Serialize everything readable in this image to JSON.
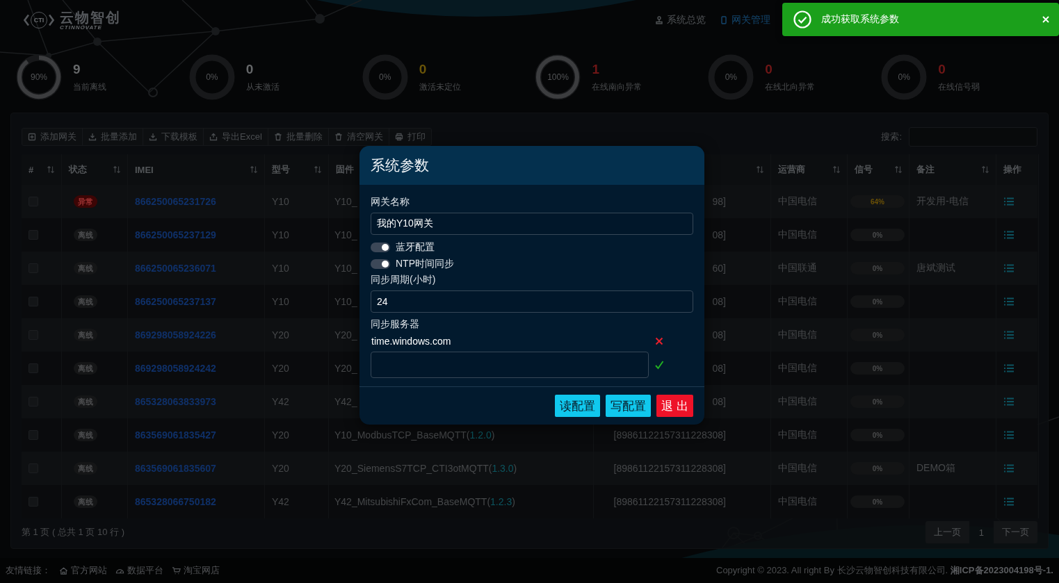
{
  "header": {
    "logo": {
      "mark": "CTI",
      "title": "云物智创",
      "subtitle": "CTINNOVATE"
    },
    "nav": [
      {
        "label": "系统总览",
        "selected": false
      },
      {
        "label": "网关管理",
        "selected": true
      }
    ]
  },
  "toast": {
    "message": "成功获取系统参数"
  },
  "stats": [
    {
      "percent": "90%",
      "level": 0.9,
      "value": "9",
      "label": "当前离线",
      "color": "#66686a"
    },
    {
      "percent": "0%",
      "value": "0",
      "label": "从未激活",
      "color": "#66686a"
    },
    {
      "percent": "0%",
      "value": "0",
      "label": "激活未定位",
      "color": "#6a5508"
    },
    {
      "percent": "100%",
      "level": 1,
      "value": "1",
      "label": "在线南向异常",
      "color": "#6e1616"
    },
    {
      "percent": "0%",
      "value": "0",
      "label": "在线北向异常",
      "color": "#6e1616"
    },
    {
      "percent": "0%",
      "value": "0",
      "label": "在线信号弱",
      "color": "#6e1616"
    }
  ],
  "toolbar": {
    "buttons": [
      "添加网关",
      "批量添加",
      "下载模板",
      "导出Excel",
      "批量删除",
      "清空网关",
      "打印"
    ],
    "search": {
      "label": "搜索:"
    }
  },
  "table": {
    "columns": [
      {
        "label": "#",
        "sortable": true
      },
      {
        "label": "状态",
        "sortable": true
      },
      {
        "label": "IMEI",
        "sortable": true
      },
      {
        "label": "型号",
        "sortable": true
      },
      {
        "label": "固件",
        "sortable": false
      },
      {
        "sortable": true
      },
      {
        "label": "运营商",
        "sortable": true
      },
      {
        "label": "信号",
        "sortable": true
      },
      {
        "label": "备注",
        "sortable": true
      },
      {
        "label": "操作",
        "sortable": false
      }
    ],
    "rows": [
      {
        "checked": false,
        "status": {
          "text": "异常",
          "kind": "error"
        },
        "imei": "866250065231726",
        "model": "Y10",
        "firmware": {
          "name": "Y10_"
        },
        "iccid": "98]",
        "carrier": "中国电信",
        "signal": {
          "text": "64%",
          "color": "#6a5006"
        },
        "remark": "开发用-电信"
      },
      {
        "checked": false,
        "status": {
          "text": "离线",
          "kind": "offline"
        },
        "imei": "866250065237129",
        "model": "Y10",
        "firmware": {
          "name": "Y10_"
        },
        "iccid": "08]",
        "carrier": "中国电信",
        "signal": {
          "text": "0%",
          "color": "#4a4b4c"
        }
      },
      {
        "checked": false,
        "status": {
          "text": "离线",
          "kind": "offline"
        },
        "imei": "866250065236071",
        "model": "Y10",
        "firmware": {
          "name": "Y10_"
        },
        "iccid": "60]",
        "carrier": "中国联通",
        "signal": {
          "text": "0%",
          "color": "#4a4b4c"
        },
        "remark": "唐斌测试"
      },
      {
        "checked": false,
        "status": {
          "text": "离线",
          "kind": "offline"
        },
        "imei": "866250065237137",
        "model": "Y10",
        "firmware": {
          "name": "Y10_"
        },
        "iccid": "08]",
        "carrier": "中国电信",
        "signal": {
          "text": "0%",
          "color": "#4a4b4c"
        }
      },
      {
        "checked": false,
        "status": {
          "text": "离线",
          "kind": "offline"
        },
        "imei": "869298058924226",
        "model": "Y20",
        "firmware": {
          "name": "Y20_"
        },
        "iccid": "08]",
        "carrier": "中国电信",
        "signal": {
          "text": "0%",
          "color": "#4a4b4c"
        }
      },
      {
        "checked": false,
        "status": {
          "text": "离线",
          "kind": "offline"
        },
        "imei": "869298058924242",
        "model": "Y20",
        "firmware": {
          "name": "Y20_"
        },
        "iccid": "08]",
        "carrier": "中国电信",
        "signal": {
          "text": "0%",
          "color": "#4a4b4c"
        }
      },
      {
        "checked": false,
        "status": {
          "text": "离线",
          "kind": "offline"
        },
        "imei": "865328063833973",
        "model": "Y42",
        "firmware": {
          "name": "Y42_"
        },
        "iccid": "08]",
        "carrier": "中国电信",
        "signal": {
          "text": "0%",
          "color": "#4a4b4c"
        }
      },
      {
        "checked": false,
        "status": {
          "text": "离线",
          "kind": "offline"
        },
        "imei": "863569061835427",
        "model": "Y20",
        "firmware": {
          "name": "Y10_ModbusTCP_BaseMQTT(",
          "version": "1.2.0",
          "close": ")"
        },
        "iccid": "[89861122157311228308]",
        "carrier": "中国电信",
        "signal": {
          "text": "0%",
          "color": "#4a4b4c"
        }
      },
      {
        "checked": false,
        "status": {
          "text": "离线",
          "kind": "offline"
        },
        "imei": "863569061835607",
        "model": "Y20",
        "firmware": {
          "name": "Y20_SiemensS7TCP_CTI3otMQTT(",
          "version": "1.3.0",
          "close": ")"
        },
        "iccid": "[89861122157311228308]",
        "carrier": "中国电信",
        "signal": {
          "text": "0%",
          "color": "#4a4b4c"
        },
        "remark": "DEMO箱"
      },
      {
        "checked": false,
        "status": {
          "text": "离线",
          "kind": "offline"
        },
        "imei": "865328066750182",
        "model": "Y42",
        "firmware": {
          "name": "Y42_MitsubishiFxCom_BaseMQTT(",
          "version": "1.2.3",
          "close": ")"
        },
        "iccid": "[89861122157311228308]",
        "carrier": "中国电信",
        "signal": {
          "text": "0%",
          "color": "#4a4b4c"
        }
      }
    ]
  },
  "pagination": {
    "summary": "第 1 页 ( 总共 1 页 10 行 )",
    "prev": "上一页",
    "pages": [
      {
        "label": "1",
        "selected": true
      }
    ],
    "next": "下一页"
  },
  "footer": {
    "links_label": "友情链接：",
    "links": [
      "官方网站",
      "数据平台",
      "淘宝网店"
    ],
    "copyright": "Copyright © 2023. All right By 长沙云物智创科技有限公司. **湘ICP备2023004198号-1.**"
  },
  "dialog": {
    "title": "系统参数",
    "fields": [
      {
        "kind": "text",
        "label": "网关名称",
        "value": "我的Y10网关"
      },
      {
        "kind": "toggle",
        "label": "蓝牙配置",
        "on": true
      },
      {
        "kind": "toggle",
        "label": "NTP时间同步",
        "on": true
      },
      {
        "kind": "text",
        "label": "同步周期(小时)",
        "value": "24"
      }
    ],
    "servers": {
      "label": "同步服务器",
      "items": [
        "time.windows.com"
      ]
    },
    "buttons": [
      {
        "label": "读配置",
        "kind": "info"
      },
      {
        "label": "写配置",
        "kind": "info"
      },
      {
        "label": "退 出",
        "kind": "danger"
      }
    ]
  }
}
